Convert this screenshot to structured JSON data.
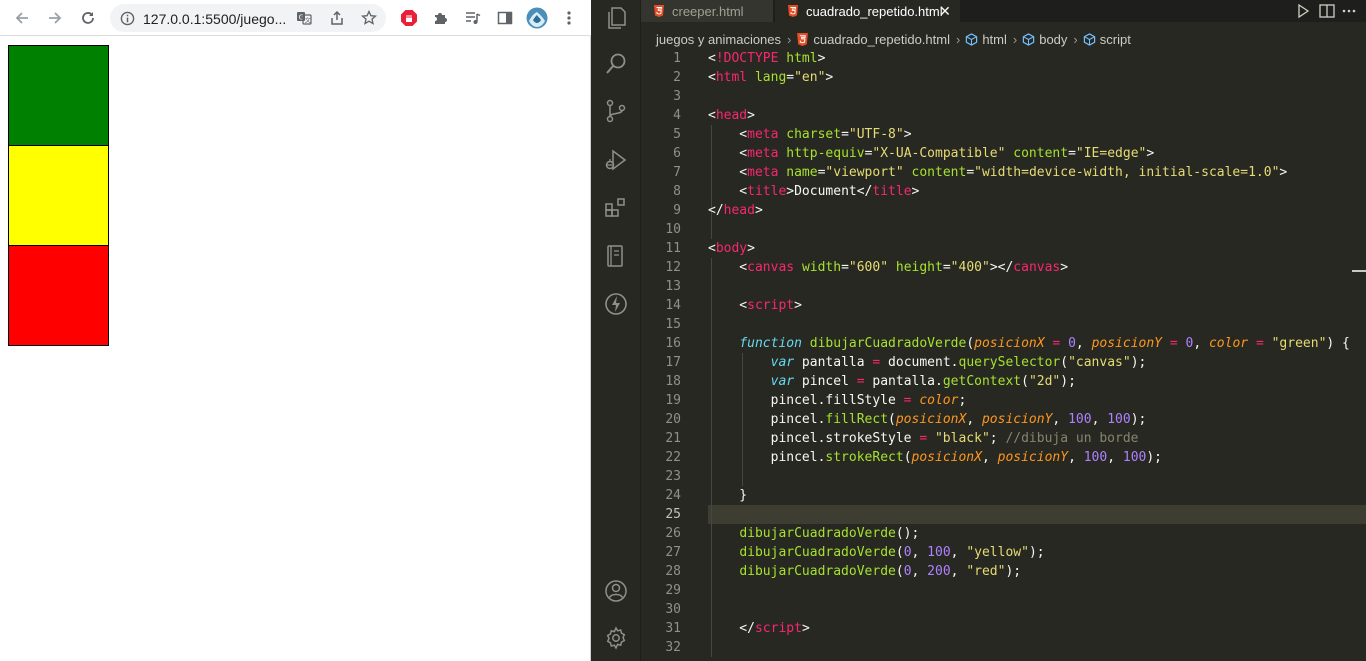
{
  "browser": {
    "url": "127.0.0.1:5500/juegos y animaciones/cuadrado_repetido.html",
    "url_display": "127.0.0.1:5500/juego...",
    "squares": [
      {
        "color": "#008000",
        "name": "green"
      },
      {
        "color": "#ffff00",
        "name": "yellow"
      },
      {
        "color": "#ff0000",
        "name": "red"
      }
    ]
  },
  "vscode": {
    "tabs": [
      {
        "label": "creeper.html",
        "active": false
      },
      {
        "label": "cuadrado_repetido.html",
        "active": true
      }
    ],
    "breadcrumbs": [
      "juegos  y animaciones",
      "cuadrado_repetido.html",
      "html",
      "body",
      "script"
    ],
    "active_line": 25,
    "colors": {
      "background": "#272822",
      "tag": "#f92672",
      "attribute": "#a6e22e",
      "string": "#e6db74",
      "keyword": "#66d9ef",
      "number": "#ae81ff",
      "parameter": "#fd971f",
      "comment": "#88846f"
    },
    "code_lines": [
      {
        "n": 1,
        "tokens": [
          [
            "pun",
            "<"
          ],
          [
            "tag",
            "!DOCTYPE"
          ],
          [
            "pun",
            " "
          ],
          [
            "att",
            "html"
          ],
          [
            "pun",
            ">"
          ]
        ]
      },
      {
        "n": 2,
        "tokens": [
          [
            "pun",
            "<"
          ],
          [
            "tag",
            "html"
          ],
          [
            "pun",
            " "
          ],
          [
            "att",
            "lang"
          ],
          [
            "pun",
            "="
          ],
          [
            "str",
            "\"en\""
          ],
          [
            "pun",
            ">"
          ]
        ]
      },
      {
        "n": 3,
        "tokens": []
      },
      {
        "n": 4,
        "tokens": [
          [
            "pun",
            "<"
          ],
          [
            "tag",
            "head"
          ],
          [
            "pun",
            ">"
          ]
        ]
      },
      {
        "n": 5,
        "tokens": [
          [
            "pun",
            "    <"
          ],
          [
            "tag",
            "meta"
          ],
          [
            "pun",
            " "
          ],
          [
            "att",
            "charset"
          ],
          [
            "pun",
            "="
          ],
          [
            "str",
            "\"UTF-8\""
          ],
          [
            "pun",
            ">"
          ]
        ]
      },
      {
        "n": 6,
        "tokens": [
          [
            "pun",
            "    <"
          ],
          [
            "tag",
            "meta"
          ],
          [
            "pun",
            " "
          ],
          [
            "att",
            "http-equiv"
          ],
          [
            "pun",
            "="
          ],
          [
            "str",
            "\"X-UA-Compatible\""
          ],
          [
            "pun",
            " "
          ],
          [
            "att",
            "content"
          ],
          [
            "pun",
            "="
          ],
          [
            "str",
            "\"IE=edge\""
          ],
          [
            "pun",
            ">"
          ]
        ]
      },
      {
        "n": 7,
        "tokens": [
          [
            "pun",
            "    <"
          ],
          [
            "tag",
            "meta"
          ],
          [
            "pun",
            " "
          ],
          [
            "att",
            "name"
          ],
          [
            "pun",
            "="
          ],
          [
            "str",
            "\"viewport\""
          ],
          [
            "pun",
            " "
          ],
          [
            "att",
            "content"
          ],
          [
            "pun",
            "="
          ],
          [
            "str",
            "\"width=device-width, initial-scale=1.0\""
          ],
          [
            "pun",
            ">"
          ]
        ]
      },
      {
        "n": 8,
        "tokens": [
          [
            "pun",
            "    <"
          ],
          [
            "tag",
            "title"
          ],
          [
            "pun",
            ">"
          ],
          [
            "txt",
            "Document"
          ],
          [
            "pun",
            "</"
          ],
          [
            "tag",
            "title"
          ],
          [
            "pun",
            ">"
          ]
        ]
      },
      {
        "n": 9,
        "tokens": [
          [
            "pun",
            "</"
          ],
          [
            "tag",
            "head"
          ],
          [
            "pun",
            ">"
          ]
        ]
      },
      {
        "n": 10,
        "tokens": []
      },
      {
        "n": 11,
        "tokens": [
          [
            "pun",
            "<"
          ],
          [
            "tag",
            "body"
          ],
          [
            "pun",
            ">"
          ]
        ]
      },
      {
        "n": 12,
        "tokens": [
          [
            "pun",
            "    <"
          ],
          [
            "tag",
            "canvas"
          ],
          [
            "pun",
            " "
          ],
          [
            "att",
            "width"
          ],
          [
            "pun",
            "="
          ],
          [
            "str",
            "\"600\""
          ],
          [
            "pun",
            " "
          ],
          [
            "att",
            "height"
          ],
          [
            "pun",
            "="
          ],
          [
            "str",
            "\"400\""
          ],
          [
            "pun",
            "></"
          ],
          [
            "tag",
            "canvas"
          ],
          [
            "pun",
            ">"
          ]
        ]
      },
      {
        "n": 13,
        "tokens": []
      },
      {
        "n": 14,
        "tokens": [
          [
            "pun",
            "    <"
          ],
          [
            "tag",
            "script"
          ],
          [
            "pun",
            ">"
          ]
        ]
      },
      {
        "n": 15,
        "tokens": []
      },
      {
        "n": 16,
        "tokens": [
          [
            "pun",
            "    "
          ],
          [
            "kw",
            "function"
          ],
          [
            "pun",
            " "
          ],
          [
            "fn",
            "dibujarCuadradoVerde"
          ],
          [
            "pun",
            "("
          ],
          [
            "par",
            "posicionX"
          ],
          [
            "pun",
            " "
          ],
          [
            "op",
            "="
          ],
          [
            "pun",
            " "
          ],
          [
            "num",
            "0"
          ],
          [
            "pun",
            ", "
          ],
          [
            "par",
            "posicionY"
          ],
          [
            "pun",
            " "
          ],
          [
            "op",
            "="
          ],
          [
            "pun",
            " "
          ],
          [
            "num",
            "0"
          ],
          [
            "pun",
            ", "
          ],
          [
            "par",
            "color"
          ],
          [
            "pun",
            " "
          ],
          [
            "op",
            "="
          ],
          [
            "pun",
            " "
          ],
          [
            "str",
            "\"green\""
          ],
          [
            "pun",
            ") {"
          ]
        ]
      },
      {
        "n": 17,
        "tokens": [
          [
            "pun",
            "        "
          ],
          [
            "kw",
            "var"
          ],
          [
            "pun",
            " pantalla "
          ],
          [
            "op",
            "="
          ],
          [
            "pun",
            " document."
          ],
          [
            "fn",
            "querySelector"
          ],
          [
            "pun",
            "("
          ],
          [
            "str",
            "\"canvas\""
          ],
          [
            "pun",
            ");"
          ]
        ]
      },
      {
        "n": 18,
        "tokens": [
          [
            "pun",
            "        "
          ],
          [
            "kw",
            "var"
          ],
          [
            "pun",
            " pincel "
          ],
          [
            "op",
            "="
          ],
          [
            "pun",
            " pantalla."
          ],
          [
            "fn",
            "getContext"
          ],
          [
            "pun",
            "("
          ],
          [
            "str",
            "\"2d\""
          ],
          [
            "pun",
            ");"
          ]
        ]
      },
      {
        "n": 19,
        "tokens": [
          [
            "pun",
            "        pincel.fillStyle "
          ],
          [
            "op",
            "="
          ],
          [
            "pun",
            " "
          ],
          [
            "par",
            "color"
          ],
          [
            "pun",
            ";"
          ]
        ]
      },
      {
        "n": 20,
        "tokens": [
          [
            "pun",
            "        pincel."
          ],
          [
            "fn",
            "fillRect"
          ],
          [
            "pun",
            "("
          ],
          [
            "par",
            "posicionX"
          ],
          [
            "pun",
            ", "
          ],
          [
            "par",
            "posicionY"
          ],
          [
            "pun",
            ", "
          ],
          [
            "num",
            "100"
          ],
          [
            "pun",
            ", "
          ],
          [
            "num",
            "100"
          ],
          [
            "pun",
            ");"
          ]
        ]
      },
      {
        "n": 21,
        "tokens": [
          [
            "pun",
            "        pincel.strokeStyle "
          ],
          [
            "op",
            "="
          ],
          [
            "pun",
            " "
          ],
          [
            "str",
            "\"black\""
          ],
          [
            "pun",
            "; "
          ],
          [
            "cmt",
            "//dibuja un borde"
          ]
        ]
      },
      {
        "n": 22,
        "tokens": [
          [
            "pun",
            "        pincel."
          ],
          [
            "fn",
            "strokeRect"
          ],
          [
            "pun",
            "("
          ],
          [
            "par",
            "posicionX"
          ],
          [
            "pun",
            ", "
          ],
          [
            "par",
            "posicionY"
          ],
          [
            "pun",
            ", "
          ],
          [
            "num",
            "100"
          ],
          [
            "pun",
            ", "
          ],
          [
            "num",
            "100"
          ],
          [
            "pun",
            ");"
          ]
        ]
      },
      {
        "n": 23,
        "tokens": []
      },
      {
        "n": 24,
        "tokens": [
          [
            "pun",
            "    }"
          ]
        ]
      },
      {
        "n": 25,
        "tokens": []
      },
      {
        "n": 26,
        "tokens": [
          [
            "pun",
            "    "
          ],
          [
            "fn",
            "dibujarCuadradoVerde"
          ],
          [
            "pun",
            "();"
          ]
        ]
      },
      {
        "n": 27,
        "tokens": [
          [
            "pun",
            "    "
          ],
          [
            "fn",
            "dibujarCuadradoVerde"
          ],
          [
            "pun",
            "("
          ],
          [
            "num",
            "0"
          ],
          [
            "pun",
            ", "
          ],
          [
            "num",
            "100"
          ],
          [
            "pun",
            ", "
          ],
          [
            "str",
            "\"yellow\""
          ],
          [
            "pun",
            ");"
          ]
        ]
      },
      {
        "n": 28,
        "tokens": [
          [
            "pun",
            "    "
          ],
          [
            "fn",
            "dibujarCuadradoVerde"
          ],
          [
            "pun",
            "("
          ],
          [
            "num",
            "0"
          ],
          [
            "pun",
            ", "
          ],
          [
            "num",
            "200"
          ],
          [
            "pun",
            ", "
          ],
          [
            "str",
            "\"red\""
          ],
          [
            "pun",
            ");"
          ]
        ]
      },
      {
        "n": 29,
        "tokens": []
      },
      {
        "n": 30,
        "tokens": []
      },
      {
        "n": 31,
        "tokens": [
          [
            "pun",
            "    </"
          ],
          [
            "tag",
            "script"
          ],
          [
            "pun",
            ">"
          ]
        ]
      },
      {
        "n": 32,
        "tokens": []
      }
    ]
  }
}
